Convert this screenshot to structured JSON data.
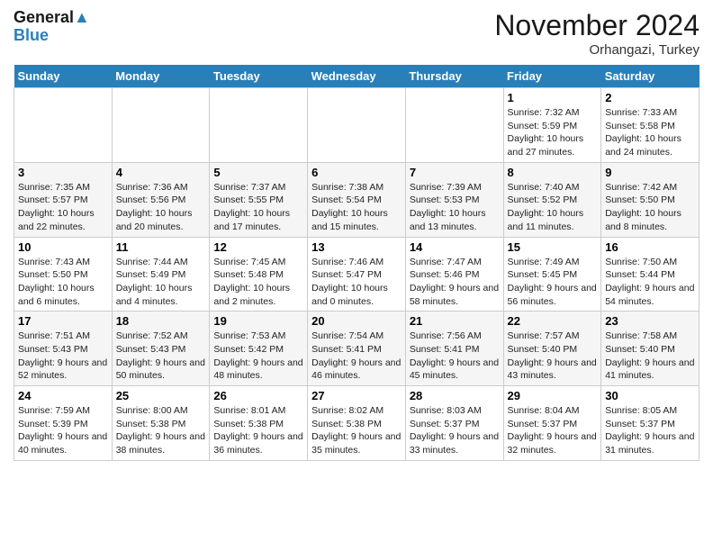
{
  "header": {
    "logo_line1": "General",
    "logo_line2": "Blue",
    "month": "November 2024",
    "location": "Orhangazi, Turkey"
  },
  "days_of_week": [
    "Sunday",
    "Monday",
    "Tuesday",
    "Wednesday",
    "Thursday",
    "Friday",
    "Saturday"
  ],
  "weeks": [
    [
      {
        "day": "",
        "info": ""
      },
      {
        "day": "",
        "info": ""
      },
      {
        "day": "",
        "info": ""
      },
      {
        "day": "",
        "info": ""
      },
      {
        "day": "",
        "info": ""
      },
      {
        "day": "1",
        "info": "Sunrise: 7:32 AM\nSunset: 5:59 PM\nDaylight: 10 hours and 27 minutes."
      },
      {
        "day": "2",
        "info": "Sunrise: 7:33 AM\nSunset: 5:58 PM\nDaylight: 10 hours and 24 minutes."
      }
    ],
    [
      {
        "day": "3",
        "info": "Sunrise: 7:35 AM\nSunset: 5:57 PM\nDaylight: 10 hours and 22 minutes."
      },
      {
        "day": "4",
        "info": "Sunrise: 7:36 AM\nSunset: 5:56 PM\nDaylight: 10 hours and 20 minutes."
      },
      {
        "day": "5",
        "info": "Sunrise: 7:37 AM\nSunset: 5:55 PM\nDaylight: 10 hours and 17 minutes."
      },
      {
        "day": "6",
        "info": "Sunrise: 7:38 AM\nSunset: 5:54 PM\nDaylight: 10 hours and 15 minutes."
      },
      {
        "day": "7",
        "info": "Sunrise: 7:39 AM\nSunset: 5:53 PM\nDaylight: 10 hours and 13 minutes."
      },
      {
        "day": "8",
        "info": "Sunrise: 7:40 AM\nSunset: 5:52 PM\nDaylight: 10 hours and 11 minutes."
      },
      {
        "day": "9",
        "info": "Sunrise: 7:42 AM\nSunset: 5:50 PM\nDaylight: 10 hours and 8 minutes."
      }
    ],
    [
      {
        "day": "10",
        "info": "Sunrise: 7:43 AM\nSunset: 5:50 PM\nDaylight: 10 hours and 6 minutes."
      },
      {
        "day": "11",
        "info": "Sunrise: 7:44 AM\nSunset: 5:49 PM\nDaylight: 10 hours and 4 minutes."
      },
      {
        "day": "12",
        "info": "Sunrise: 7:45 AM\nSunset: 5:48 PM\nDaylight: 10 hours and 2 minutes."
      },
      {
        "day": "13",
        "info": "Sunrise: 7:46 AM\nSunset: 5:47 PM\nDaylight: 10 hours and 0 minutes."
      },
      {
        "day": "14",
        "info": "Sunrise: 7:47 AM\nSunset: 5:46 PM\nDaylight: 9 hours and 58 minutes."
      },
      {
        "day": "15",
        "info": "Sunrise: 7:49 AM\nSunset: 5:45 PM\nDaylight: 9 hours and 56 minutes."
      },
      {
        "day": "16",
        "info": "Sunrise: 7:50 AM\nSunset: 5:44 PM\nDaylight: 9 hours and 54 minutes."
      }
    ],
    [
      {
        "day": "17",
        "info": "Sunrise: 7:51 AM\nSunset: 5:43 PM\nDaylight: 9 hours and 52 minutes."
      },
      {
        "day": "18",
        "info": "Sunrise: 7:52 AM\nSunset: 5:43 PM\nDaylight: 9 hours and 50 minutes."
      },
      {
        "day": "19",
        "info": "Sunrise: 7:53 AM\nSunset: 5:42 PM\nDaylight: 9 hours and 48 minutes."
      },
      {
        "day": "20",
        "info": "Sunrise: 7:54 AM\nSunset: 5:41 PM\nDaylight: 9 hours and 46 minutes."
      },
      {
        "day": "21",
        "info": "Sunrise: 7:56 AM\nSunset: 5:41 PM\nDaylight: 9 hours and 45 minutes."
      },
      {
        "day": "22",
        "info": "Sunrise: 7:57 AM\nSunset: 5:40 PM\nDaylight: 9 hours and 43 minutes."
      },
      {
        "day": "23",
        "info": "Sunrise: 7:58 AM\nSunset: 5:40 PM\nDaylight: 9 hours and 41 minutes."
      }
    ],
    [
      {
        "day": "24",
        "info": "Sunrise: 7:59 AM\nSunset: 5:39 PM\nDaylight: 9 hours and 40 minutes."
      },
      {
        "day": "25",
        "info": "Sunrise: 8:00 AM\nSunset: 5:38 PM\nDaylight: 9 hours and 38 minutes."
      },
      {
        "day": "26",
        "info": "Sunrise: 8:01 AM\nSunset: 5:38 PM\nDaylight: 9 hours and 36 minutes."
      },
      {
        "day": "27",
        "info": "Sunrise: 8:02 AM\nSunset: 5:38 PM\nDaylight: 9 hours and 35 minutes."
      },
      {
        "day": "28",
        "info": "Sunrise: 8:03 AM\nSunset: 5:37 PM\nDaylight: 9 hours and 33 minutes."
      },
      {
        "day": "29",
        "info": "Sunrise: 8:04 AM\nSunset: 5:37 PM\nDaylight: 9 hours and 32 minutes."
      },
      {
        "day": "30",
        "info": "Sunrise: 8:05 AM\nSunset: 5:37 PM\nDaylight: 9 hours and 31 minutes."
      }
    ]
  ]
}
